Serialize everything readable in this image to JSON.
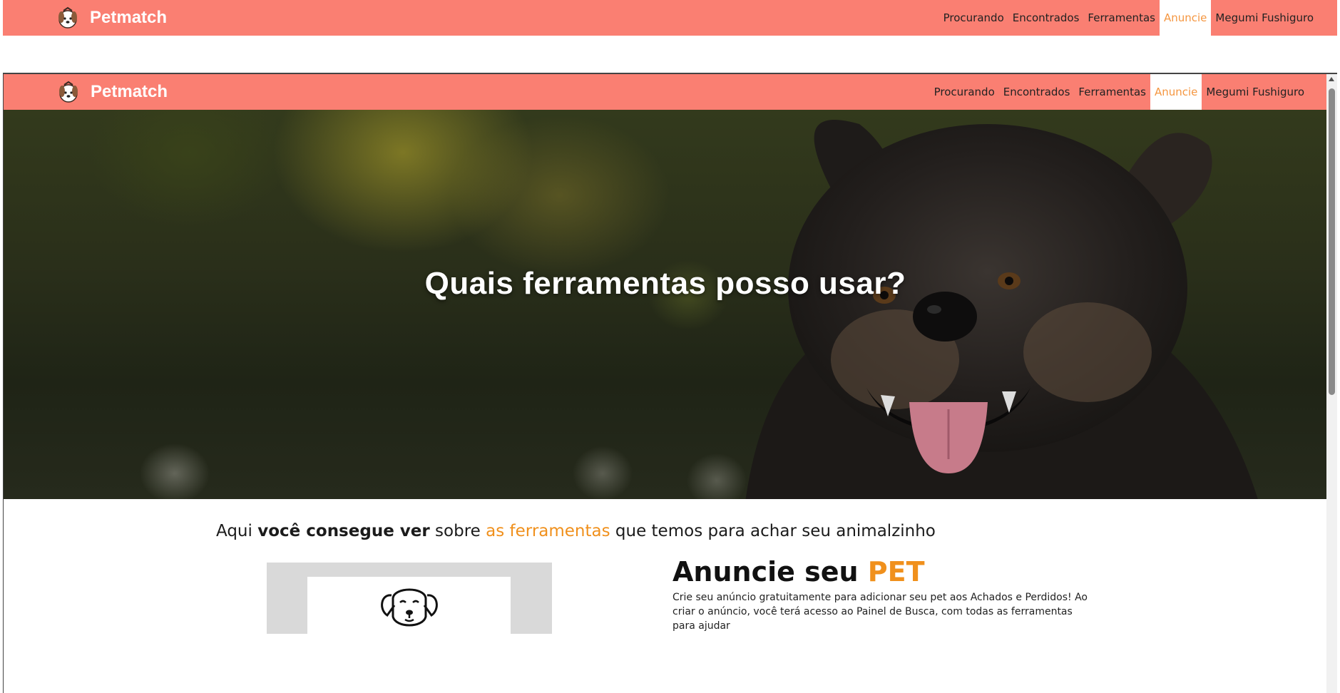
{
  "brand": {
    "name": "Petmatch",
    "logo_icon": "dog-logo-icon"
  },
  "nav": {
    "items": [
      {
        "label": "Procurando",
        "active": false
      },
      {
        "label": "Encontrados",
        "active": false
      },
      {
        "label": "Ferramentas",
        "active": false
      },
      {
        "label": "Anuncie",
        "active": true
      },
      {
        "label": "Megumi Fushiguro",
        "active": false
      }
    ]
  },
  "hero": {
    "title": "Quais ferramentas posso usar?"
  },
  "intro": {
    "part1": "Aqui ",
    "part2": "você consegue ver",
    "part3": " sobre ",
    "part4": "as ferramentas",
    "part5": " que temos para achar seu animalzinho"
  },
  "section": {
    "title_part1": "Anuncie seu ",
    "title_part2": "PET",
    "text": "Crie seu anúncio gratuitamente para adicionar seu pet aos Achados e Perdidos! Ao criar o anúncio, você terá acesso ao Painel de Busca, com todas as ferramentas para ajudar"
  },
  "colors": {
    "nav_bg": "#fa7f72",
    "accent": "#f0901c",
    "active_link": "#f59640"
  }
}
